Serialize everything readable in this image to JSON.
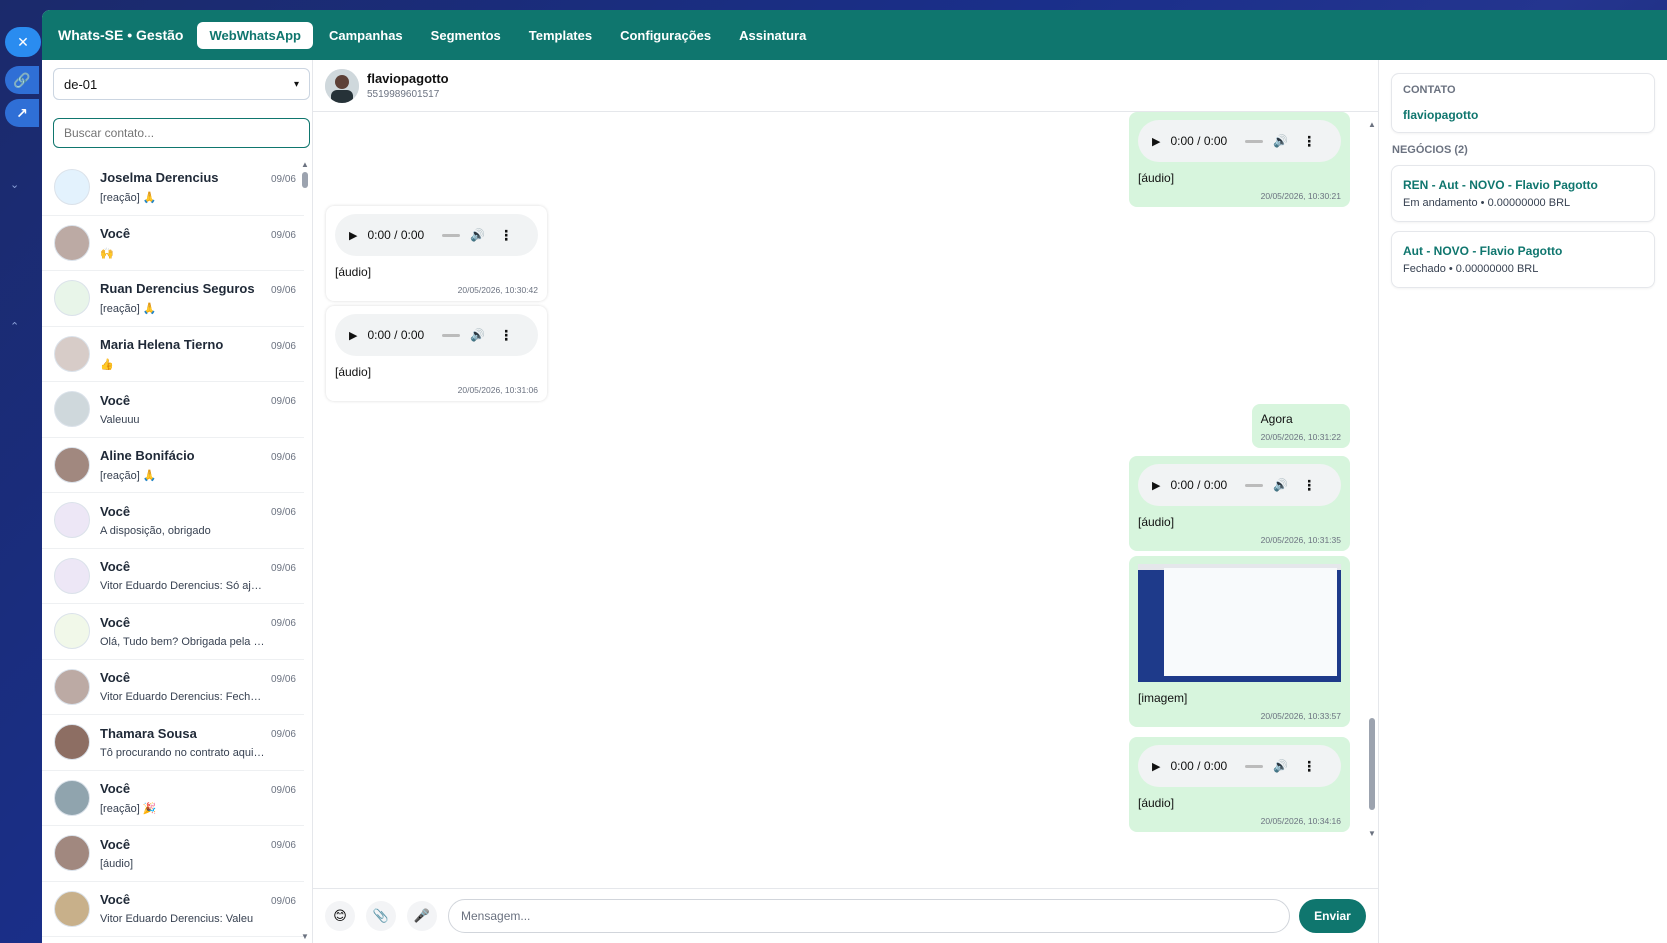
{
  "app": {
    "brand": "Whats-SE • Gestão",
    "nav": [
      {
        "label": "WebWhatsApp",
        "active": true
      },
      {
        "label": "Campanhas"
      },
      {
        "label": "Segmentos"
      },
      {
        "label": "Templates"
      },
      {
        "label": "Configurações"
      },
      {
        "label": "Assinatura"
      }
    ]
  },
  "contacts_panel": {
    "instance_select": "de-01",
    "search_placeholder": "Buscar contato...",
    "items": [
      {
        "name": "Joselma Derencius",
        "preview": "[reação] 🙏",
        "date": "09/06"
      },
      {
        "name": "Você",
        "preview": "🙌",
        "date": "09/06"
      },
      {
        "name": "Ruan Derencius Seguros",
        "preview": "[reação] 🙏",
        "date": "09/06"
      },
      {
        "name": "Maria Helena Tierno",
        "preview": "👍",
        "date": "09/06"
      },
      {
        "name": "Você",
        "preview": "Valeuuu",
        "date": "09/06"
      },
      {
        "name": "Aline Bonifácio",
        "preview": "[reação] 🙏",
        "date": "09/06"
      },
      {
        "name": "Você",
        "preview": "A disposição, obrigado",
        "date": "09/06"
      },
      {
        "name": "Você",
        "preview": "Vitor Eduardo Derencius: Só ajustar na ...",
        "date": "09/06"
      },
      {
        "name": "Você",
        "preview": "Olá, Tudo bem? Obrigada pela sua me...",
        "date": "09/06"
      },
      {
        "name": "Você",
        "preview": "Vitor Eduardo Derencius: Fechado, no ...",
        "date": "09/06"
      },
      {
        "name": "Thamara Sousa",
        "preview": "Tô procurando no contrato aqui o que ...",
        "date": "09/06"
      },
      {
        "name": "Você",
        "preview": "[reação] 🎉",
        "date": "09/06"
      },
      {
        "name": "Você",
        "preview": "[áudio]",
        "date": "09/06"
      },
      {
        "name": "Você",
        "preview": "Vitor Eduardo Derencius: Valeu",
        "date": "09/06"
      }
    ]
  },
  "chat": {
    "name": "flaviopagotto",
    "phone": "5519989601517",
    "audio_time": "0:00 / 0:00",
    "messages": [
      {
        "dir": "out",
        "type": "audio",
        "label": "[áudio]",
        "ts": "20/05/2026, 10:30:21"
      },
      {
        "dir": "in",
        "type": "audio",
        "label": "[áudio]",
        "ts": "20/05/2026, 10:30:42"
      },
      {
        "dir": "in",
        "type": "audio",
        "label": "[áudio]",
        "ts": "20/05/2026, 10:31:06"
      },
      {
        "dir": "out",
        "type": "text",
        "label": "Agora",
        "ts": "20/05/2026, 10:31:22"
      },
      {
        "dir": "out",
        "type": "audio",
        "label": "[áudio]",
        "ts": "20/05/2026, 10:31:35"
      },
      {
        "dir": "out",
        "type": "image",
        "label": "[imagem]",
        "ts": "20/05/2026, 10:33:57"
      },
      {
        "dir": "out",
        "type": "audio",
        "label": "[áudio]",
        "ts": "20/05/2026, 10:34:16"
      }
    ],
    "composer": {
      "placeholder": "Mensagem...",
      "send_label": "Enviar",
      "emoji_icon": "😊",
      "attach_icon": "📎",
      "mic_icon": "🎤"
    }
  },
  "side_panel": {
    "contact_title": "CONTATO",
    "contact_name": "flaviopagotto",
    "deals_title": "NEGÓCIOS (2)",
    "deals": [
      {
        "name": "REN - Aut - NOVO - Flavio Pagotto",
        "status": "Em andamento • 0.00000000 BRL"
      },
      {
        "name": "Aut - NOVO - Flavio Pagotto",
        "status": "Fechado • 0.00000000 BRL"
      }
    ]
  },
  "colors": {
    "brand": "#0f766e",
    "bubble_out": "#d7f5dd"
  }
}
